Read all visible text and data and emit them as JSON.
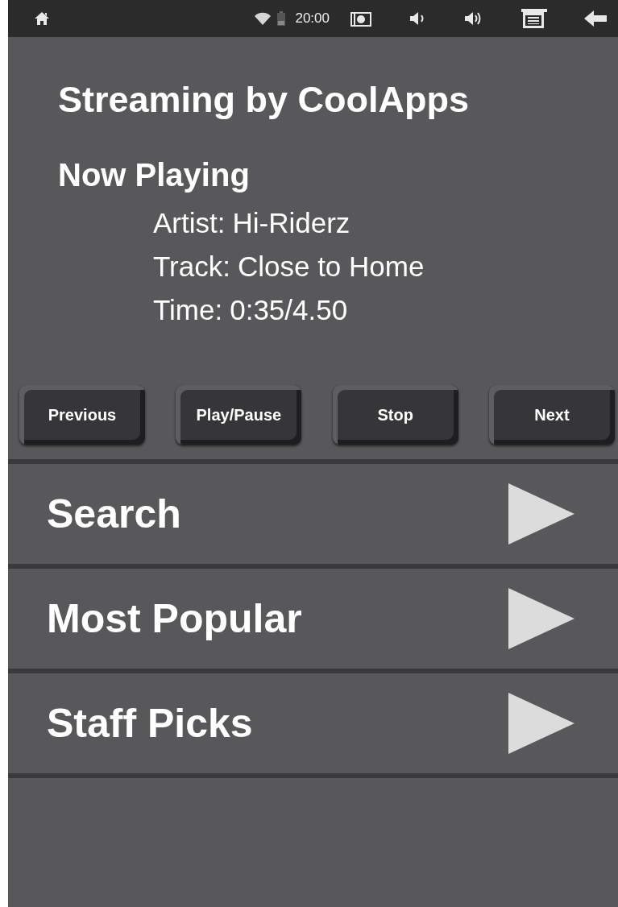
{
  "status_bar": {
    "time": "20:00"
  },
  "title": "Streaming by CoolApps",
  "now_playing": {
    "heading": "Now Playing",
    "fields": [
      {
        "label": "Artist:",
        "value": "Hi-Riderz"
      },
      {
        "label": "Track:",
        "value": "Close to Home"
      },
      {
        "label": "Time:",
        "value": "0:35/4.50"
      }
    ]
  },
  "controls": [
    "Previous",
    "Play/Pause",
    "Stop",
    "Next"
  ],
  "menu": [
    {
      "label": "Search"
    },
    {
      "label": "Most Popular"
    },
    {
      "label": "Staff Picks"
    }
  ]
}
